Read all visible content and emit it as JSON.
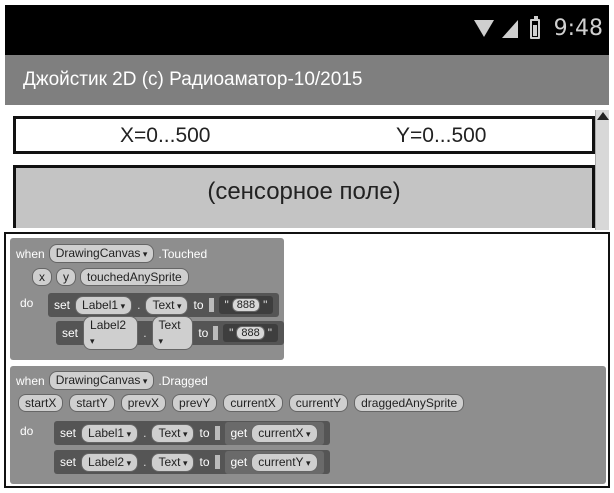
{
  "status_bar": {
    "time": "9:48"
  },
  "app": {
    "title": "Джойстик 2D (с) Радиоаматор-10/2015"
  },
  "coords": {
    "x_label": "X=0...500",
    "y_label": "Y=0...500"
  },
  "touch_field": {
    "label": "(сенсорное поле)"
  },
  "blocks": {
    "touched": {
      "when": "when",
      "component": "DrawingCanvas",
      "event": ".Touched",
      "params": [
        "x",
        "y",
        "touchedAnySprite"
      ],
      "do": "do",
      "statements": [
        {
          "set": "set",
          "component": "Label1",
          "dot": ".",
          "property": "Text",
          "to": "to",
          "value": "888"
        },
        {
          "set": "set",
          "component": "Label2",
          "dot": ".",
          "property": "Text",
          "to": "to",
          "value": "888"
        }
      ]
    },
    "dragged": {
      "when": "when",
      "component": "DrawingCanvas",
      "event": ".Dragged",
      "params": [
        "startX",
        "startY",
        "prevX",
        "prevY",
        "currentX",
        "currentY",
        "draggedAnySprite"
      ],
      "do": "do",
      "statements": [
        {
          "set": "set",
          "component": "Label1",
          "dot": ".",
          "property": "Text",
          "to": "to",
          "get": "get",
          "value": "currentX"
        },
        {
          "set": "set",
          "component": "Label2",
          "dot": ".",
          "property": "Text",
          "to": "to",
          "get": "get",
          "value": "currentY"
        }
      ]
    }
  },
  "icons": [
    "wifi-icon",
    "signal-icon",
    "battery-icon",
    "scroll-up-icon"
  ]
}
